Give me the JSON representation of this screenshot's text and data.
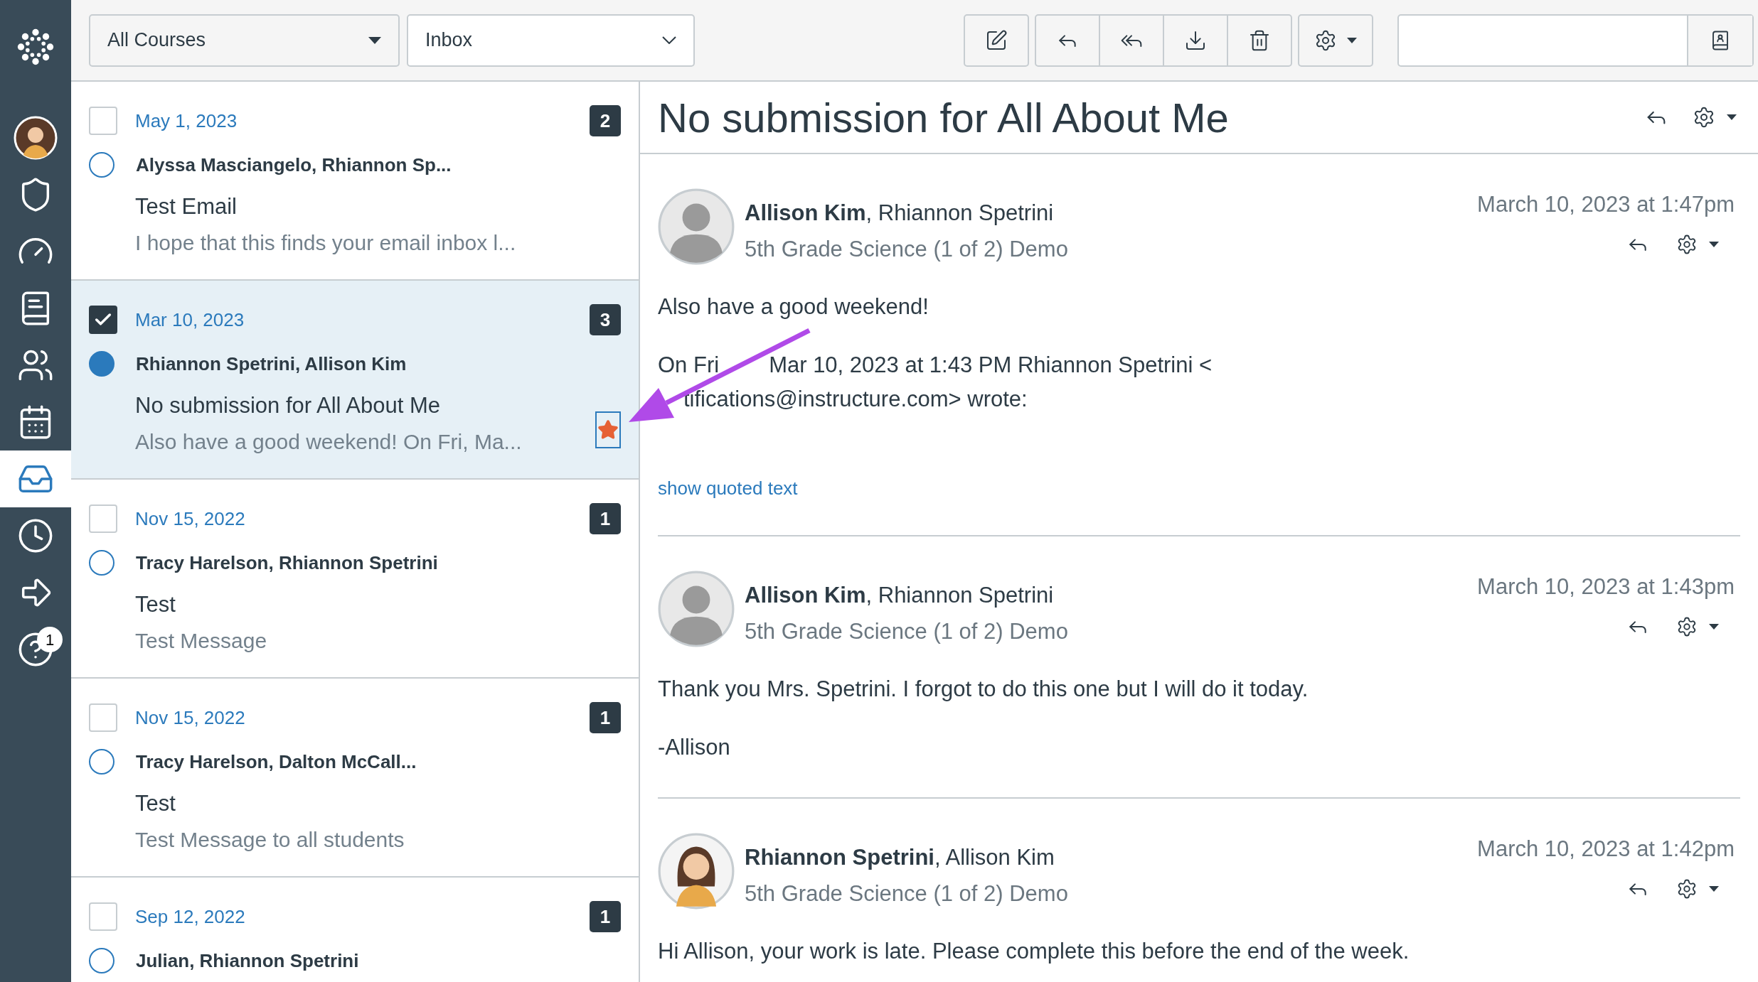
{
  "nav": {
    "items": [
      {
        "kind": "account",
        "selected": false
      },
      {
        "kind": "admin",
        "selected": false
      },
      {
        "kind": "dashboard",
        "selected": false
      },
      {
        "kind": "courses",
        "selected": false
      },
      {
        "kind": "groups",
        "selected": false
      },
      {
        "kind": "calendar",
        "selected": false
      },
      {
        "kind": "inbox",
        "selected": true
      },
      {
        "kind": "history",
        "selected": false
      },
      {
        "kind": "commons",
        "selected": false
      },
      {
        "kind": "help",
        "selected": false,
        "badge": "1"
      }
    ]
  },
  "toolbar": {
    "course_filter": "All Courses",
    "mailbox": "Inbox"
  },
  "conversations": [
    {
      "date": "May 1, 2023",
      "participants": "Alyssa Masciangelo, Rhiannon Sp...",
      "subject": "Test Email",
      "preview": "I hope that this finds your email inbox l...",
      "count": "2",
      "checked": false,
      "unread": false,
      "starred": false,
      "selected": false
    },
    {
      "date": "Mar 10, 2023",
      "participants": "Rhiannon Spetrini, Allison Kim",
      "subject": "No submission for All About Me",
      "preview": "Also have a good weekend! On Fri, Ma...",
      "count": "3",
      "checked": true,
      "unread": true,
      "starred": true,
      "selected": true
    },
    {
      "date": "Nov 15, 2022",
      "participants": "Tracy Harelson, Rhiannon Spetrini",
      "subject": "Test",
      "preview": "Test Message",
      "count": "1",
      "checked": false,
      "unread": false,
      "starred": false,
      "selected": false
    },
    {
      "date": "Nov 15, 2022",
      "participants": "Tracy Harelson, Dalton McCall...",
      "subject": "Test",
      "preview": "Test Message to all students",
      "count": "1",
      "checked": false,
      "unread": false,
      "starred": false,
      "selected": false
    },
    {
      "date": "Sep 12, 2022",
      "participants": "Julian, Rhiannon Spetrini",
      "count": "1",
      "checked": false,
      "unread": false,
      "starred": false,
      "selected": false
    }
  ],
  "thread": {
    "title": "No submission for All About Me",
    "messages": [
      {
        "author": "Allison Kim",
        "others": ", Rhiannon Spetrini",
        "course": "5th Grade Science (1 of 2) Demo",
        "date": "March 10, 2023 at 1:47pm",
        "kind": "default",
        "body": [
          [
            {
              "segments": [
                "Also have a good weekend!"
              ],
              "covered_start": false
            }
          ],
          [
            {
              "segments": [
                "On Fri",
                "Mar 10, 2023 at 1:43 PM Rhiannon Spetrini <"
              ],
              "covered_start": false
            },
            {
              "segments": [
                "tifications@instructure.com> wrote:"
              ],
              "covered_start": true
            }
          ]
        ],
        "quoted_link": "show quoted text"
      },
      {
        "author": "Allison Kim",
        "others": ", Rhiannon Spetrini",
        "course": "5th Grade Science (1 of 2) Demo",
        "date": "March 10, 2023 at 1:43pm",
        "kind": "default",
        "body": [
          [
            {
              "segments": [
                "Thank you Mrs. Spetrini. I forgot to do this one but I will do it today."
              ],
              "covered_start": false
            }
          ],
          [
            {
              "segments": [
                "-Allison"
              ],
              "covered_start": false
            }
          ]
        ]
      },
      {
        "author": "Rhiannon Spetrini",
        "others": ", Allison Kim",
        "course": "5th Grade Science (1 of 2) Demo",
        "date": "March 10, 2023 at 1:42pm",
        "kind": "figure",
        "body": [
          [
            {
              "segments": [
                "Hi Allison, your work is late. Please complete this before the end of the week."
              ],
              "covered_start": false
            }
          ]
        ]
      }
    ]
  }
}
